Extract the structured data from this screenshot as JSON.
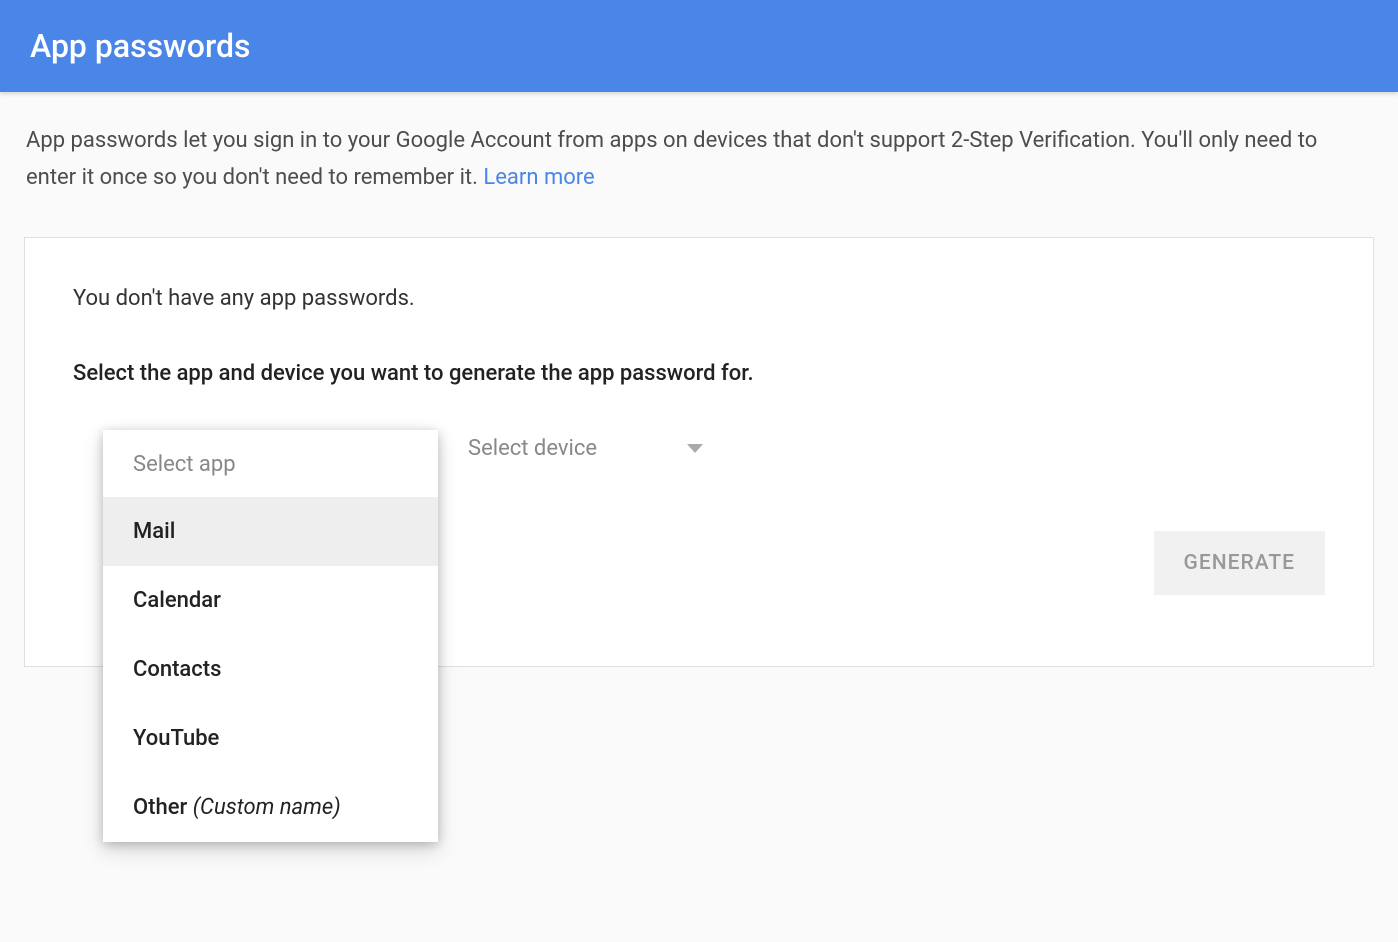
{
  "header": {
    "title": "App passwords"
  },
  "description": {
    "text": "App passwords let you sign in to your Google Account from apps on devices that don't support 2-Step Verification. You'll only need to enter it once so you don't need to remember it. ",
    "learn_more": "Learn more"
  },
  "card": {
    "no_passwords": "You don't have any app passwords.",
    "instruction": "Select the app and device you want to generate the app password for.",
    "select_app": {
      "label": "Select app",
      "options": [
        {
          "label": "Mail",
          "highlighted": true
        },
        {
          "label": "Calendar",
          "highlighted": false
        },
        {
          "label": "Contacts",
          "highlighted": false
        },
        {
          "label": "YouTube",
          "highlighted": false
        },
        {
          "label": "Other ",
          "hint": "(Custom name)",
          "highlighted": false
        }
      ]
    },
    "select_device": {
      "label": "Select device"
    },
    "generate_button": "GENERATE"
  }
}
